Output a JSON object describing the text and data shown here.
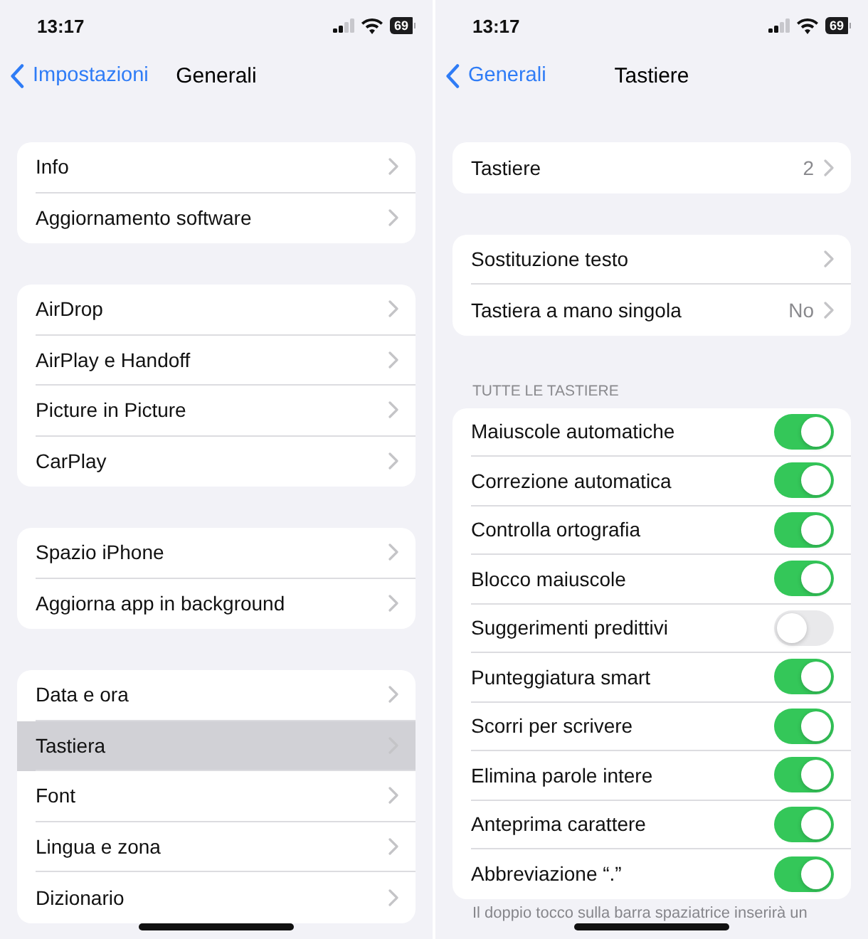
{
  "screens": [
    {
      "status_bar": {
        "time": "13:17",
        "battery": "69"
      },
      "nav": {
        "back": "Impostazioni",
        "title": "Generali"
      },
      "groups": [
        {
          "rows": [
            {
              "kind": "link",
              "label": "Info",
              "selected": false
            },
            {
              "kind": "link",
              "label": "Aggiornamento software",
              "selected": false
            }
          ]
        },
        {
          "rows": [
            {
              "kind": "link",
              "label": "AirDrop",
              "selected": false
            },
            {
              "kind": "link",
              "label": "AirPlay e Handoff",
              "selected": false
            },
            {
              "kind": "link",
              "label": "Picture in Picture",
              "selected": false
            },
            {
              "kind": "link",
              "label": "CarPlay",
              "selected": false
            }
          ]
        },
        {
          "rows": [
            {
              "kind": "link",
              "label": "Spazio iPhone",
              "selected": false
            },
            {
              "kind": "link",
              "label": "Aggiorna app in background",
              "selected": false
            }
          ]
        },
        {
          "rows": [
            {
              "kind": "link",
              "label": "Data e ora",
              "selected": false
            },
            {
              "kind": "link",
              "label": "Tastiera",
              "selected": true
            },
            {
              "kind": "link",
              "label": "Font",
              "selected": false
            },
            {
              "kind": "link",
              "label": "Lingua e zona",
              "selected": false
            },
            {
              "kind": "link",
              "label": "Dizionario",
              "selected": false
            }
          ]
        }
      ]
    },
    {
      "status_bar": {
        "time": "13:17",
        "battery": "69"
      },
      "nav": {
        "back": "Generali",
        "title": "Tastiere"
      },
      "groups": [
        {
          "rows": [
            {
              "kind": "link",
              "label": "Tastiere",
              "value": "2",
              "selected": false
            }
          ]
        },
        {
          "rows": [
            {
              "kind": "link",
              "label": "Sostituzione testo",
              "selected": false
            },
            {
              "kind": "link",
              "label": "Tastiera a mano singola",
              "value": "No",
              "selected": false
            }
          ]
        },
        {
          "header": "TUTTE LE TASTIERE",
          "rows": [
            {
              "kind": "toggle",
              "label": "Maiuscole automatiche",
              "on": true
            },
            {
              "kind": "toggle",
              "label": "Correzione automatica",
              "on": true
            },
            {
              "kind": "toggle",
              "label": "Controlla ortografia",
              "on": true
            },
            {
              "kind": "toggle",
              "label": "Blocco maiuscole",
              "on": true
            },
            {
              "kind": "toggle",
              "label": "Suggerimenti predittivi",
              "on": false
            },
            {
              "kind": "toggle",
              "label": "Punteggiatura smart",
              "on": true
            },
            {
              "kind": "toggle",
              "label": "Scorri per scrivere",
              "on": true
            },
            {
              "kind": "toggle",
              "label": "Elimina parole intere",
              "on": true
            },
            {
              "kind": "toggle",
              "label": "Anteprima carattere",
              "on": true
            },
            {
              "kind": "toggle",
              "label": "Abbreviazione “.”",
              "on": true
            }
          ]
        }
      ],
      "footer": "Il doppio tocco sulla barra spaziatrice inserirà un"
    }
  ]
}
